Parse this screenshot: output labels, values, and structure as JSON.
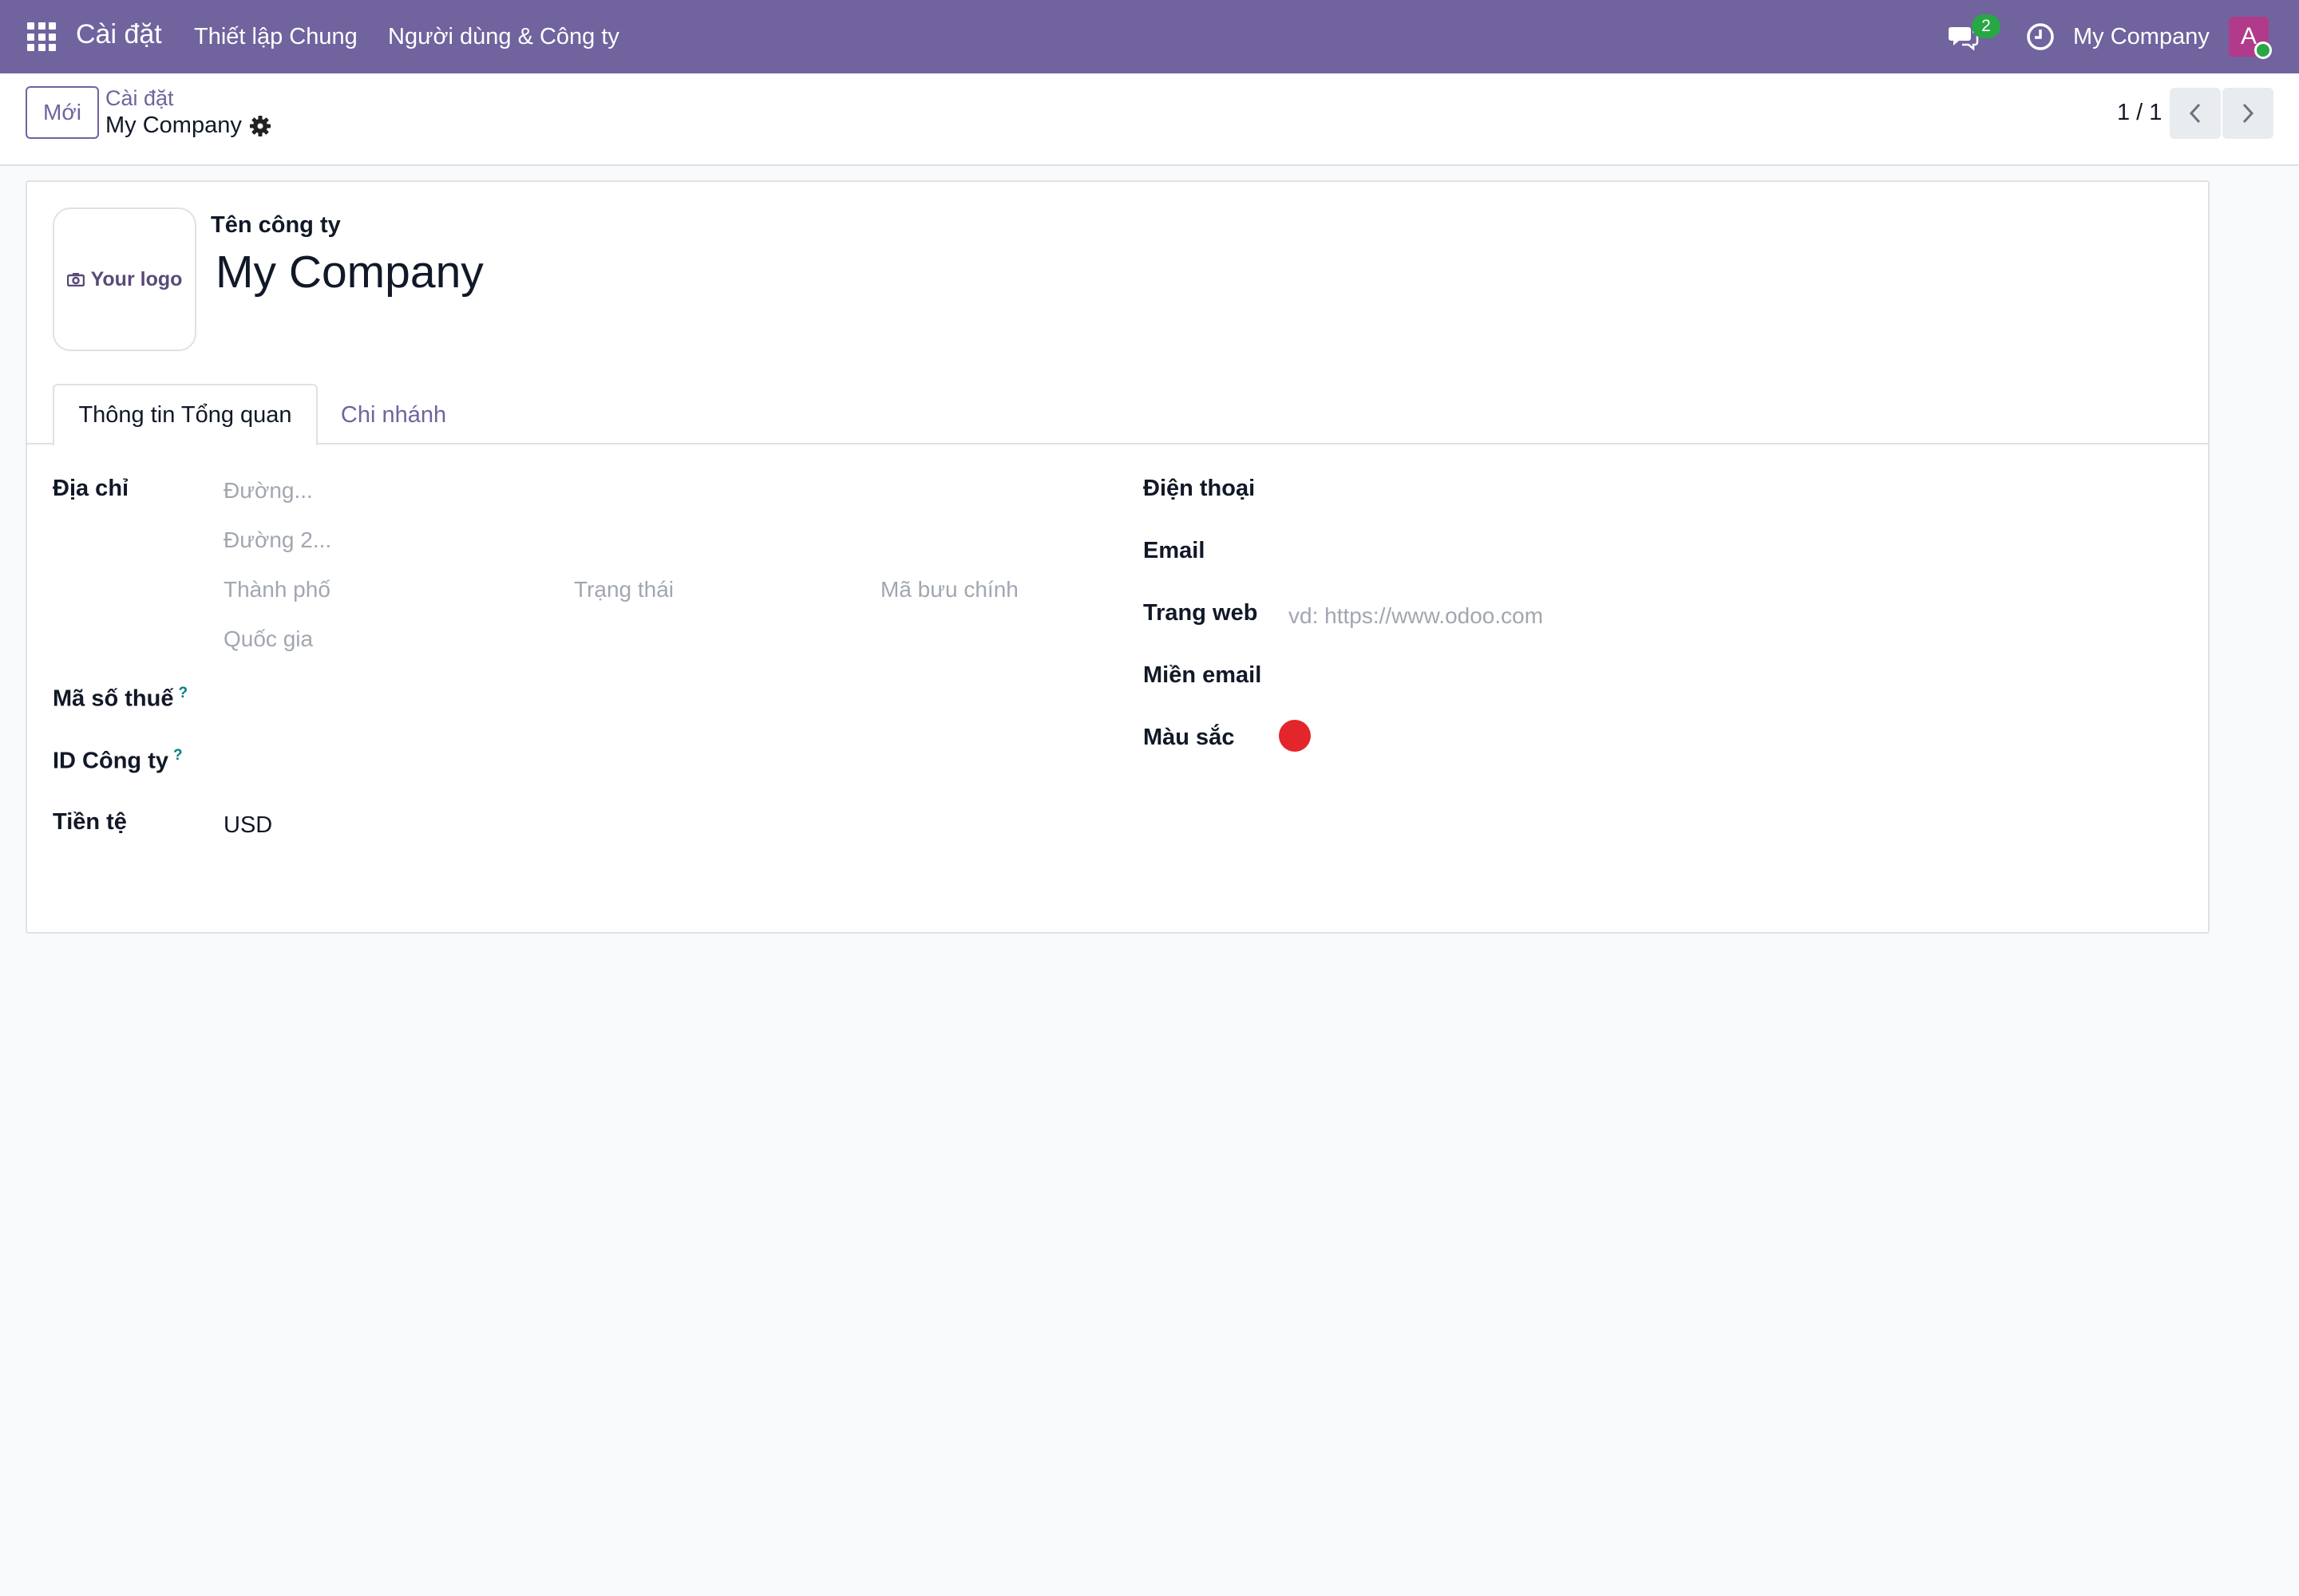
{
  "navbar": {
    "app_name": "Cài đặt",
    "menu": [
      "Thiết lập Chung",
      "Người dùng & Công ty"
    ],
    "messages_count": "2",
    "company": "My Company",
    "avatar_initial": "A",
    "icons": {
      "apps": "apps-grid-icon",
      "chat": "chat-icon",
      "activity": "clock-icon"
    }
  },
  "control_panel": {
    "new_button": "Mới",
    "breadcrumb_parent": "Cài đặt",
    "breadcrumb_current": "My Company",
    "pager": "1 / 1"
  },
  "form": {
    "logo_text": "Your logo",
    "company_name_label": "Tên công ty",
    "company_name": "My Company",
    "tabs": [
      "Thông tin Tổng quan",
      "Chi nhánh"
    ],
    "address_label": "Địa chỉ",
    "address_placeholders": {
      "street": "Đường...",
      "street2": "Đường 2...",
      "city": "Thành phố",
      "state": "Trạng thái",
      "zip": "Mã bưu chính",
      "country": "Quốc gia"
    },
    "tax_id_label": "Mã số thuế",
    "company_id_label": "ID Công ty",
    "currency_label": "Tiền tệ",
    "currency_value": "USD",
    "phone_label": "Điện thoại",
    "email_label": "Email",
    "website_label": "Trang web",
    "website_placeholder": "vd: https://www.odoo.com",
    "email_domain_label": "Miền email",
    "color_label": "Màu sắc",
    "help_marker": "?"
  },
  "colors": {
    "brand": "#71639e",
    "company_color": "#e3262c",
    "badge": "#28a745"
  }
}
